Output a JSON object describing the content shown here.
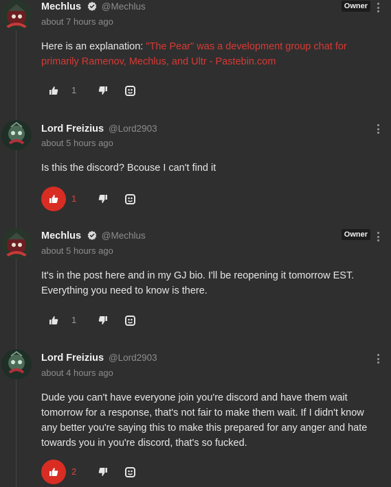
{
  "comments": [
    {
      "author": "Mechlus",
      "handle": "@Mechlus",
      "timestamp": "about 7 hours ago",
      "badge": "Owner",
      "body_prefix": "Here is an explanation: ",
      "body_link": "\"The Pear\" was a development group chat for primarily Ramenov, Mechlus, and Ultr - Pastebin.com",
      "likes": "1",
      "liked": false
    },
    {
      "author": "Lord Freizius",
      "handle": "@Lord2903",
      "timestamp": "about 5 hours ago",
      "body": "Is this the discord? Bcouse I can't find it",
      "likes": "1",
      "liked": true
    },
    {
      "author": "Mechlus",
      "handle": "@Mechlus",
      "timestamp": "about 5 hours ago",
      "badge": "Owner",
      "body": "It's in the post here and in my GJ bio. I'll be reopening it tomorrow EST. Everything you need to know is there.",
      "likes": "1",
      "liked": false
    },
    {
      "author": "Lord Freizius",
      "handle": "@Lord2903",
      "timestamp": "about 4 hours ago",
      "body": "Dude you can't have everyone join you're discord and have them wait tomorrow for a response, that's not fair to make them wait. If I didn't know any better you're saying this to make this prepared for any anger and hate towards you in you're discord, that's so fucked.",
      "likes": "2",
      "liked": true
    }
  ],
  "colors": {
    "background": "#2f2f2f",
    "accent": "#d92d24",
    "link": "#d63a35",
    "muted": "#8d8d8d"
  },
  "icons": {
    "like": "thumbs-up-icon",
    "dislike": "thumbs-down-icon",
    "gj": "gamejolt-icon",
    "more": "vertical-ellipsis-icon",
    "verified": "verified-badge-icon"
  }
}
